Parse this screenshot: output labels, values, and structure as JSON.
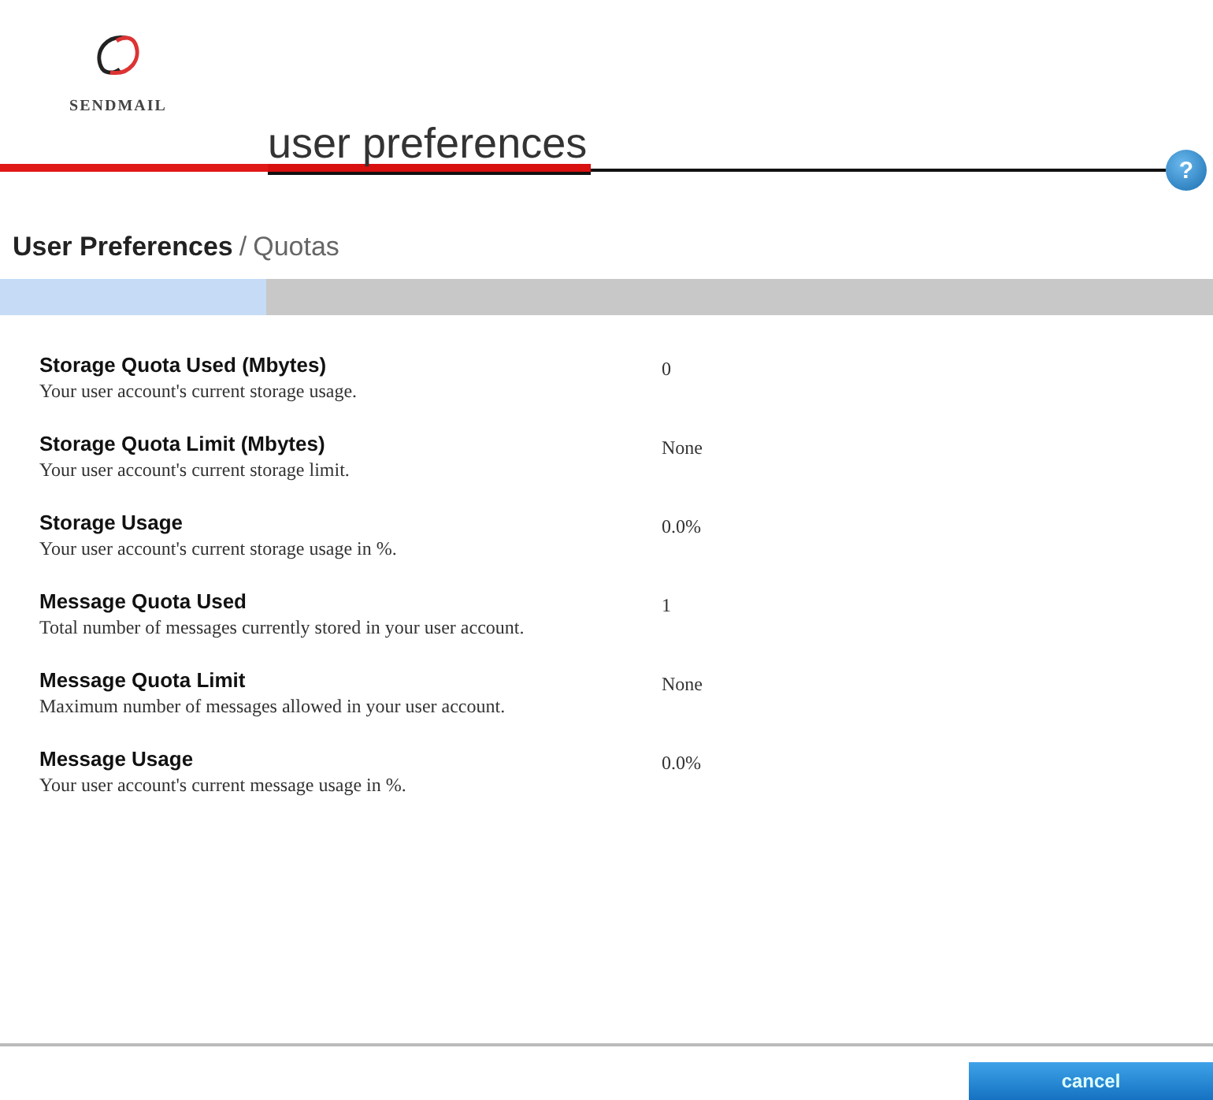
{
  "logo": {
    "text": "SENDMAIL"
  },
  "header": {
    "title": "user preferences",
    "help": "?"
  },
  "breadcrumb": {
    "parent": "User Preferences",
    "separator": "/",
    "current": "Quotas"
  },
  "progress": {
    "level": 0.22
  },
  "rows": [
    {
      "label": "Storage Quota Used (Mbytes)",
      "description": "Your user account's current storage usage.",
      "value": "0"
    },
    {
      "label": "Storage Quota Limit (Mbytes)",
      "description": "Your user account's current storage limit.",
      "value": "None"
    },
    {
      "label": "Storage Usage",
      "description": "Your user account's current storage usage in %.",
      "value": "0.0%"
    },
    {
      "label": "Message Quota Used",
      "description": "Total number of messages currently stored in your user account.",
      "value": "1"
    },
    {
      "label": "Message Quota Limit",
      "description": "Maximum number of messages allowed in your user account.",
      "value": "None"
    },
    {
      "label": "Message Usage",
      "description": "Your user account's current message usage in %.",
      "value": "0.0%"
    }
  ],
  "buttons": [
    {
      "label": "cancel"
    }
  ]
}
